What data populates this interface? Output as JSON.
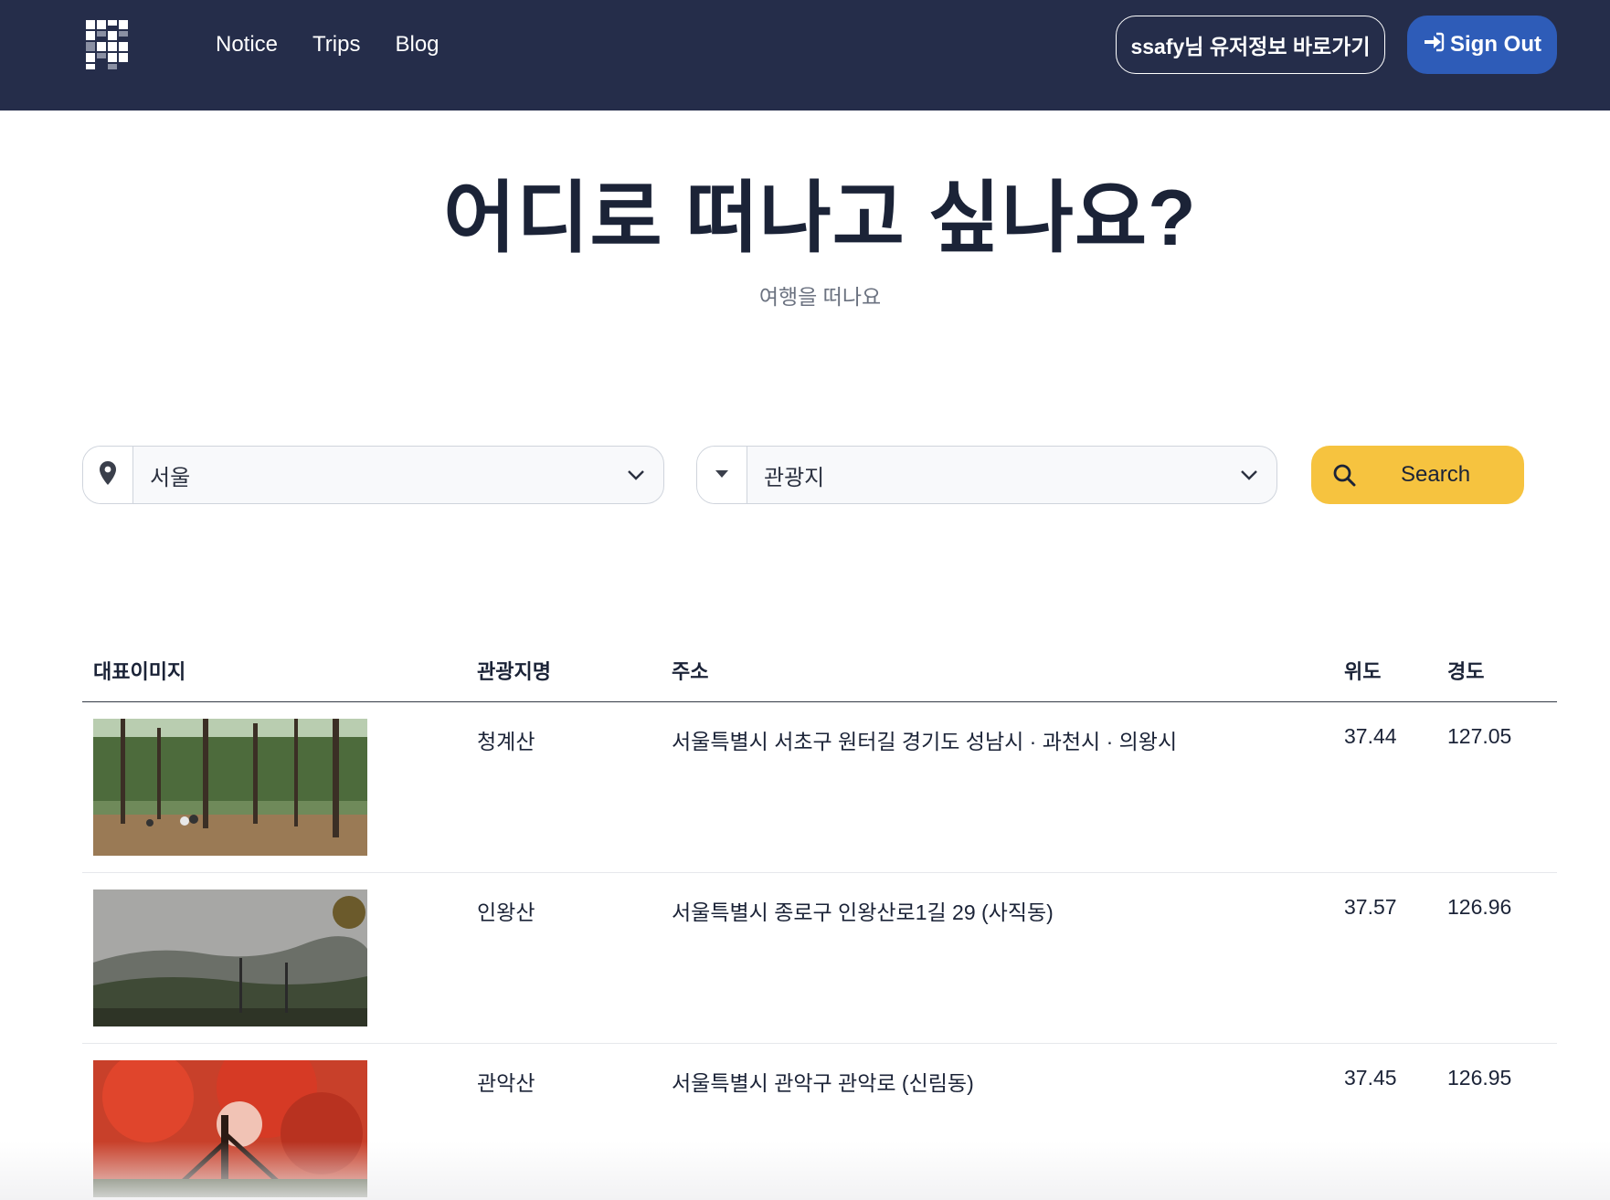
{
  "nav": {
    "links": [
      "Notice",
      "Trips",
      "Blog"
    ],
    "user_button": "ssafy님 유저정보 바로가기",
    "signout_button": "Sign Out"
  },
  "hero": {
    "title": "어디로 떠나고 싶나요?",
    "subtitle": "여행을 떠나요"
  },
  "search": {
    "region_value": "서울",
    "type_value": "관광지",
    "button_label": "Search"
  },
  "table": {
    "headers": [
      "대표이미지",
      "관광지명",
      "주소",
      "위도",
      "경도"
    ],
    "rows": [
      {
        "name": "청계산",
        "address": "서울특별시 서초구 원터길 경기도 성남시 · 과천시 · 의왕시",
        "lat": "37.44",
        "lng": "127.05"
      },
      {
        "name": "인왕산",
        "address": "서울특별시 종로구 인왕산로1길 29 (사직동)",
        "lat": "37.57",
        "lng": "126.96"
      },
      {
        "name": "관악산",
        "address": "서울특별시 관악구 관악로 (신림동)",
        "lat": "37.45",
        "lng": "126.95"
      }
    ]
  },
  "colors": {
    "navbar": "#252d4a",
    "signout": "#2e5cb8",
    "search": "#f6c33f",
    "title": "#1b2337"
  },
  "icons": {
    "logo": "logo-icon",
    "signout": "sign-in-arrow-icon",
    "region": "map-pin-icon",
    "type": "caret-down-icon",
    "chevron": "chevron-down-icon",
    "search": "search-icon"
  }
}
